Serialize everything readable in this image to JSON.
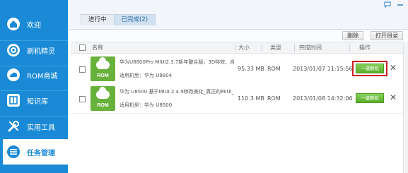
{
  "sidebar": {
    "items": [
      {
        "label": "欢迎",
        "icon": "home-icon"
      },
      {
        "label": "刷机精灵",
        "icon": "flash-icon"
      },
      {
        "label": "ROM商城",
        "icon": "cloud-icon"
      },
      {
        "label": "知识库",
        "icon": "book-icon"
      },
      {
        "label": "实用工具",
        "icon": "tools-icon"
      },
      {
        "label": "任务管理",
        "icon": "task-list-icon"
      }
    ],
    "active_index": 5
  },
  "window": {
    "feedback_icon": "chat-bubble-icon",
    "minimize_icon": "minimize-icon"
  },
  "tabs": [
    {
      "label": "进行中"
    },
    {
      "label": "已完成(2)"
    }
  ],
  "toolbar": {
    "delete_label": "删除",
    "open_dir_label": "打开目录"
  },
  "table": {
    "columns": {
      "name": "名称",
      "size": "大小",
      "type": "类型",
      "time": "完成时间",
      "op": "操作"
    },
    "rows": [
      {
        "thumb_label": "ROM",
        "title": "华为U8800Pro MIUI2.3.7新年整合版，3D特效、自由",
        "model": "适用机型：华为 U8804",
        "size": "95.33 MB",
        "type": "ROM",
        "time": "2013/01/07 11:15:56",
        "action": "一键刷机"
      },
      {
        "thumb_label": "ROM",
        "title": "华为 U8500 基于MIUI 2.4.9移改美化_真正的MIUI_非",
        "model": "适用机型：华为 U8500",
        "size": "110.3 MB",
        "type": "ROM",
        "time": "2013/01/08 14:32:06",
        "action": "一键刷机"
      }
    ]
  },
  "colors": {
    "sidebar": "#1a8ad6",
    "accent_green": "#5aac2d",
    "highlight_red": "#cc1f1f"
  }
}
